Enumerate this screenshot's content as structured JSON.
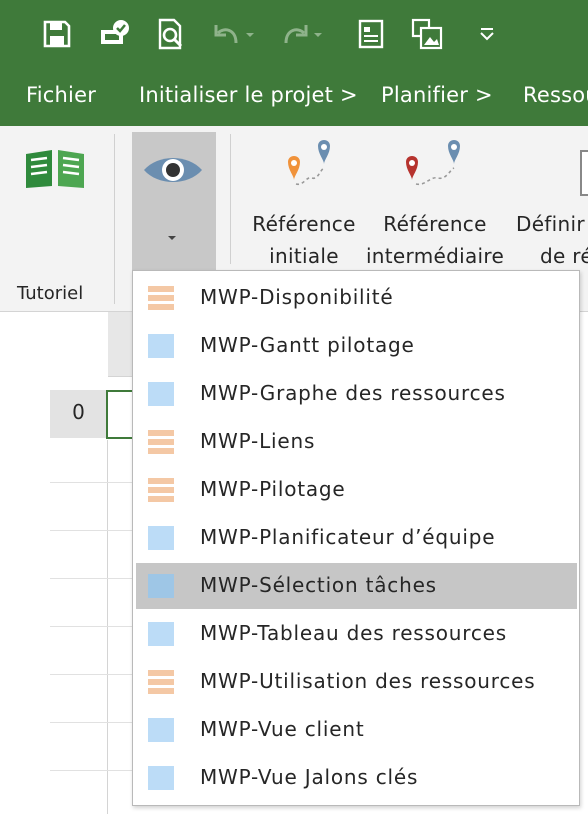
{
  "quick_access": {
    "icons": [
      "save-icon",
      "sync-icon",
      "print-preview-icon",
      "undo-icon",
      "redo-icon",
      "document-icon",
      "image-icon",
      "customize-icon"
    ]
  },
  "tabs": [
    {
      "label": "Fichier"
    },
    {
      "label": "Initialiser le projet >"
    },
    {
      "label": "Planifier >"
    },
    {
      "label": "Ressou"
    }
  ],
  "ribbon": {
    "tutorial_group_label": "Tutoriel",
    "buttons": {
      "baseline": {
        "line1": "Référence",
        "line2": "initiale"
      },
      "interim": {
        "line1": "Référence",
        "line2": "intermédiaire"
      },
      "define": {
        "line1": "Définir",
        "line2": "de ré"
      }
    }
  },
  "grid": {
    "row_number": "0"
  },
  "dropdown": {
    "items": [
      {
        "label": "MWP-Disponibilité",
        "icon": "usage-view-icon",
        "selected": false
      },
      {
        "label": "MWP-Gantt pilotage",
        "icon": "task-view-icon",
        "selected": false
      },
      {
        "label": "MWP-Graphe des ressources",
        "icon": "task-view-icon",
        "selected": false
      },
      {
        "label": "MWP-Liens",
        "icon": "usage-view-icon",
        "selected": false
      },
      {
        "label": "MWP-Pilotage",
        "icon": "usage-view-icon",
        "selected": false
      },
      {
        "label": "MWP-Planificateur d’équipe",
        "icon": "task-view-icon",
        "selected": false
      },
      {
        "label": "MWP-Sélection tâches",
        "icon": "task-view-icon",
        "selected": true
      },
      {
        "label": "MWP-Tableau des ressources",
        "icon": "task-view-icon",
        "selected": false
      },
      {
        "label": "MWP-Utilisation des ressources",
        "icon": "usage-view-icon",
        "selected": false
      },
      {
        "label": "MWP-Vue client",
        "icon": "task-view-icon",
        "selected": false
      },
      {
        "label": "MWP-Vue Jalons clés",
        "icon": "task-view-icon",
        "selected": false
      }
    ]
  },
  "colors": {
    "title_bar": "#3f7a3a",
    "selected_item": "#c6c6c6",
    "task_icon": "#bcdcf7",
    "usage_icon": "#f4c8a5"
  }
}
